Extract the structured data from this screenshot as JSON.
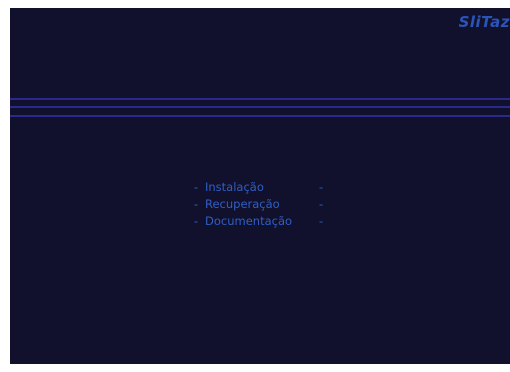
{
  "brand": {
    "name": "SliTaz"
  },
  "menu": {
    "items": [
      {
        "label": "Instalação",
        "prefix": "-",
        "suffix": "-"
      },
      {
        "label": "Recuperação",
        "prefix": "-",
        "suffix": "-"
      },
      {
        "label": "Documentação",
        "prefix": "-",
        "suffix": "-"
      }
    ]
  },
  "colors": {
    "background": "#12112d",
    "text": "#2f5ec5",
    "lines": "#2a2a8e"
  }
}
